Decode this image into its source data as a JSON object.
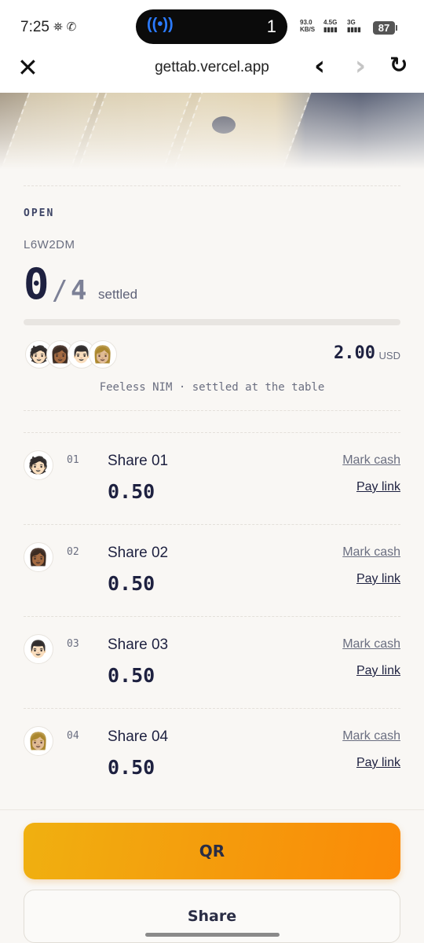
{
  "status_bar": {
    "time": "7:25",
    "notif_icons": "⛯ ✆",
    "island_icon": "((•))",
    "island_count": "1",
    "net_speed_value": "93.0",
    "net_speed_unit": "KB/S",
    "sig1_label": "4.5G",
    "sig2_label": "3G",
    "battery": "87"
  },
  "browser": {
    "url": "gettab.vercel.app",
    "close_icon": "close-icon",
    "back_icon": "chevron-left-icon",
    "forward_icon": "chevron-right-icon",
    "reload_icon": "reload-icon"
  },
  "tab": {
    "status": "OPEN",
    "code": "L6W2DM",
    "settled_count": "0",
    "slash": "/",
    "total_shares": "4",
    "settled_label": "settled",
    "progress_fraction": 0,
    "total_amount": "2.00",
    "currency": "USD",
    "note": "Feeless NIM · settled at the table",
    "avatars": [
      "🧑🏻",
      "👩🏾",
      "👨🏻",
      "👩🏼"
    ]
  },
  "shares": [
    {
      "avatar": "🧑🏻",
      "num": "01",
      "name": "Share 01",
      "amount": "0.50",
      "cash_label": "Mark cash",
      "pay_label": "Pay link"
    },
    {
      "avatar": "👩🏾",
      "num": "02",
      "name": "Share 02",
      "amount": "0.50",
      "cash_label": "Mark cash",
      "pay_label": "Pay link"
    },
    {
      "avatar": "👨🏻",
      "num": "03",
      "name": "Share 03",
      "amount": "0.50",
      "cash_label": "Mark cash",
      "pay_label": "Pay link"
    },
    {
      "avatar": "👩🏼",
      "num": "04",
      "name": "Share 04",
      "amount": "0.50",
      "cash_label": "Mark cash",
      "pay_label": "Pay link"
    }
  ],
  "actions": {
    "qr_label": "QR",
    "share_label": "Share"
  },
  "colors": {
    "accent_start": "#f0b010",
    "accent_end": "#fb8a07",
    "text_primary": "#1e2140",
    "background": "#f9f7f4"
  }
}
